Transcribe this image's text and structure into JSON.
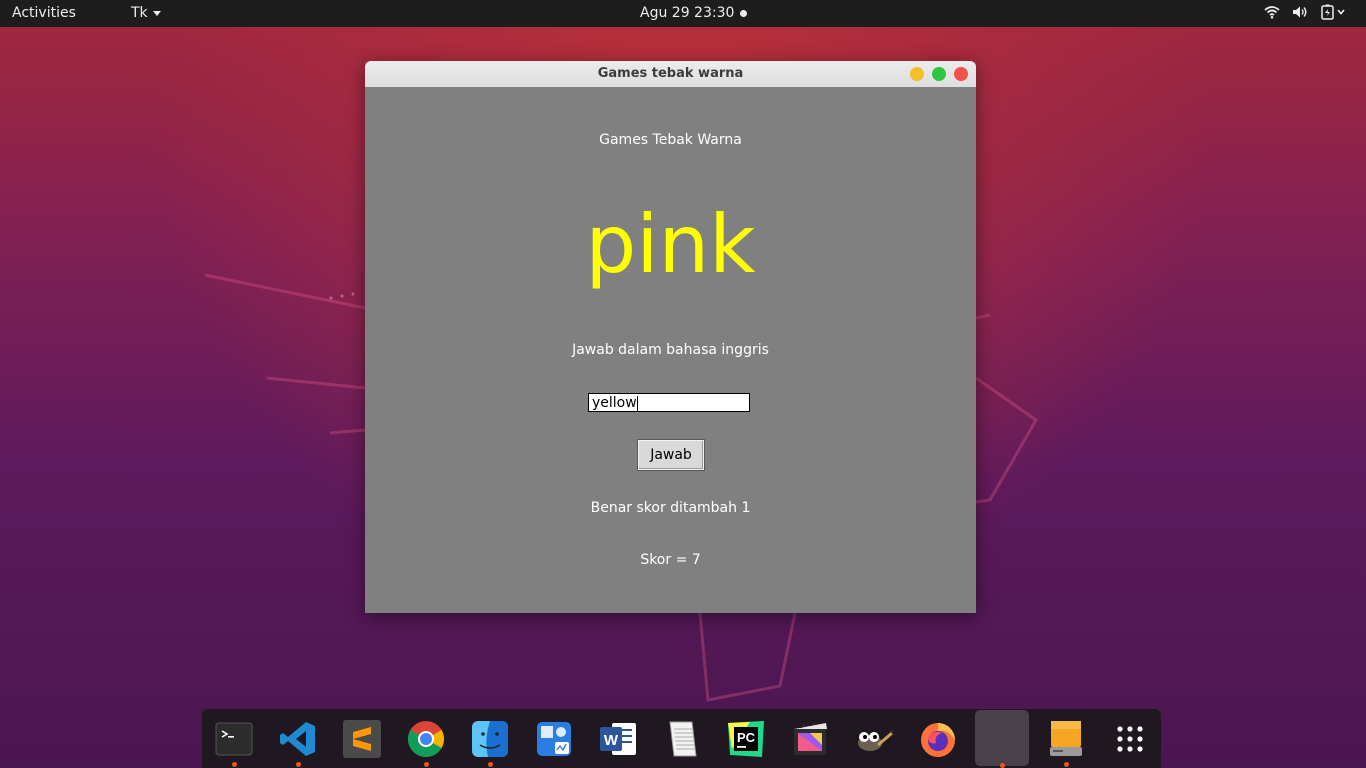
{
  "topbar": {
    "activities": "Activities",
    "app_menu": "Tk",
    "clock": "Agu 29  23:30"
  },
  "window": {
    "title": "Games tebak warna",
    "heading": "Games Tebak Warna",
    "color_word": "pink",
    "color_word_color": "#ffff00",
    "instruction": "Jawab dalam bahasa inggris",
    "answer_value": "yellow",
    "answer_button": "Jawab",
    "result": "Benar skor ditambah 1",
    "score": "Skor = 7"
  },
  "dock": {
    "items": [
      "terminal-icon",
      "vscode-icon",
      "sublime-text-icon",
      "chrome-icon",
      "finder-icon",
      "app-store-icon",
      "word-icon",
      "text-editor-icon",
      "pycharm-icon",
      "final-cut-icon",
      "gimp-icon",
      "firefox-icon",
      "active-window-icon",
      "drive-icon",
      "show-apps-icon"
    ],
    "accent": "#e95420"
  }
}
